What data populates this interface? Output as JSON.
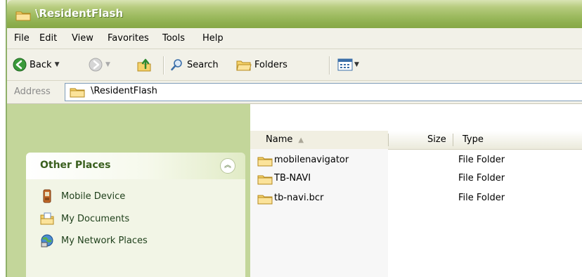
{
  "window": {
    "title": "\\ResidentFlash"
  },
  "menu": {
    "items": [
      "File",
      "Edit",
      "View",
      "Favorites",
      "Tools",
      "Help"
    ]
  },
  "toolbar": {
    "back_label": "Back",
    "search_label": "Search",
    "folders_label": "Folders"
  },
  "address": {
    "label": "Address",
    "value": "\\ResidentFlash"
  },
  "other_places": {
    "title": "Other Places",
    "items": [
      {
        "label": "Mobile Device",
        "icon": "mobile-device-icon"
      },
      {
        "label": "My Documents",
        "icon": "my-documents-icon"
      },
      {
        "label": "My Network Places",
        "icon": "network-places-icon"
      }
    ]
  },
  "columns": {
    "name": "Name",
    "size": "Size",
    "type": "Type"
  },
  "files": [
    {
      "name": "mobilenavigator",
      "size": "",
      "type": "File Folder"
    },
    {
      "name": "TB-NAVI",
      "size": "",
      "type": "File Folder"
    },
    {
      "name": "tb-navi.bcr",
      "size": "",
      "type": "File Folder"
    }
  ],
  "colors": {
    "title_bar": "#9fbc62",
    "task_pane": "#c3d69a",
    "panel_title": "#3a5f1e",
    "folder": "#f5d26b"
  }
}
